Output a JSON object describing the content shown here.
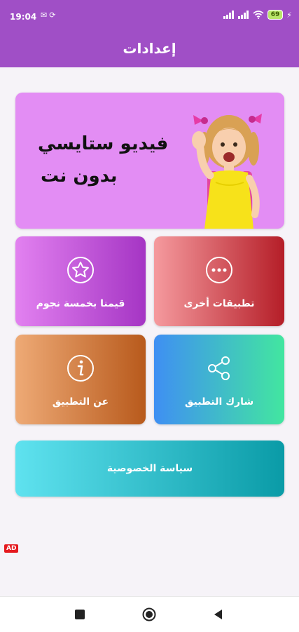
{
  "status_bar": {
    "time": "19:04",
    "battery": "69",
    "icons": [
      "mail-icon",
      "sync-icon",
      "signal-icon",
      "signal-icon",
      "wifi-icon",
      "battery-icon",
      "charging-icon"
    ]
  },
  "app_bar": {
    "title": "إعدادات"
  },
  "banner": {
    "line1": "فيديو ستايسي",
    "line2": "بدون نت",
    "background": "#e38df4"
  },
  "tiles": {
    "rate": {
      "label": "قيمنا بخمسة نجوم",
      "icon": "star-icon"
    },
    "other_apps": {
      "label": "تطبيقات أخرى",
      "icon": "more-icon"
    },
    "about": {
      "label": "عن التطبيق",
      "icon": "info-icon"
    },
    "share": {
      "label": "شارك التطبيق",
      "icon": "share-icon"
    }
  },
  "privacy": {
    "label": "سياسة الخصوصية"
  },
  "ad_badge": "AD",
  "colors": {
    "accent": "#a04fc6",
    "rate_gradient": [
      "#e281f0",
      "#a535c4"
    ],
    "other_gradient": [
      "#f59a9e",
      "#b51e28"
    ],
    "about_gradient": [
      "#eeaa76",
      "#b85a1c"
    ],
    "share_gradient": [
      "#3f8ff3",
      "#42e6a0"
    ],
    "privacy_gradient": [
      "#5fe2ef",
      "#0a9ba7"
    ]
  },
  "nav_bar": {
    "buttons": [
      "recents-icon",
      "home-icon",
      "back-icon"
    ]
  }
}
